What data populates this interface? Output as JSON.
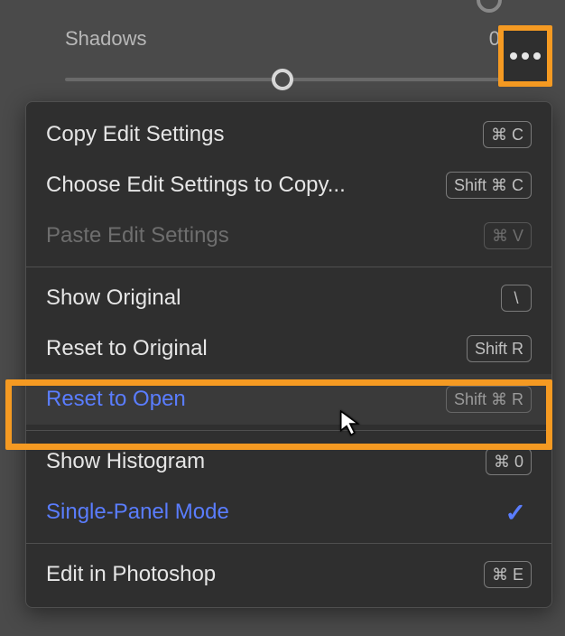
{
  "slider": {
    "label": "Shadows",
    "value": "0"
  },
  "menu": {
    "items": [
      {
        "label": "Copy Edit Settings",
        "shortcut": "⌘ C",
        "state": "normal"
      },
      {
        "label": "Choose Edit Settings to Copy...",
        "shortcut": "Shift ⌘ C",
        "state": "normal"
      },
      {
        "label": "Paste Edit Settings",
        "shortcut": "⌘ V",
        "state": "disabled"
      },
      {
        "divider": true
      },
      {
        "label": "Show Original",
        "shortcut": "\\",
        "state": "normal"
      },
      {
        "label": "Reset to Original",
        "shortcut": "Shift R",
        "state": "normal"
      },
      {
        "label": "Reset to Open",
        "shortcut": "Shift ⌘ R",
        "state": "hovered"
      },
      {
        "divider": true
      },
      {
        "label": "Show Histogram",
        "shortcut": "⌘ 0",
        "state": "normal"
      },
      {
        "label": "Single-Panel Mode",
        "shortcut": "",
        "state": "highlighted",
        "checked": true
      },
      {
        "divider": true
      },
      {
        "label": "Edit in Photoshop",
        "shortcut": "⌘ E",
        "state": "normal"
      }
    ]
  },
  "colors": {
    "accent": "#5a7dff",
    "highlightBorder": "#f59a22",
    "panelBg": "#4a4a4a",
    "menuBg": "#2f2f2f"
  }
}
